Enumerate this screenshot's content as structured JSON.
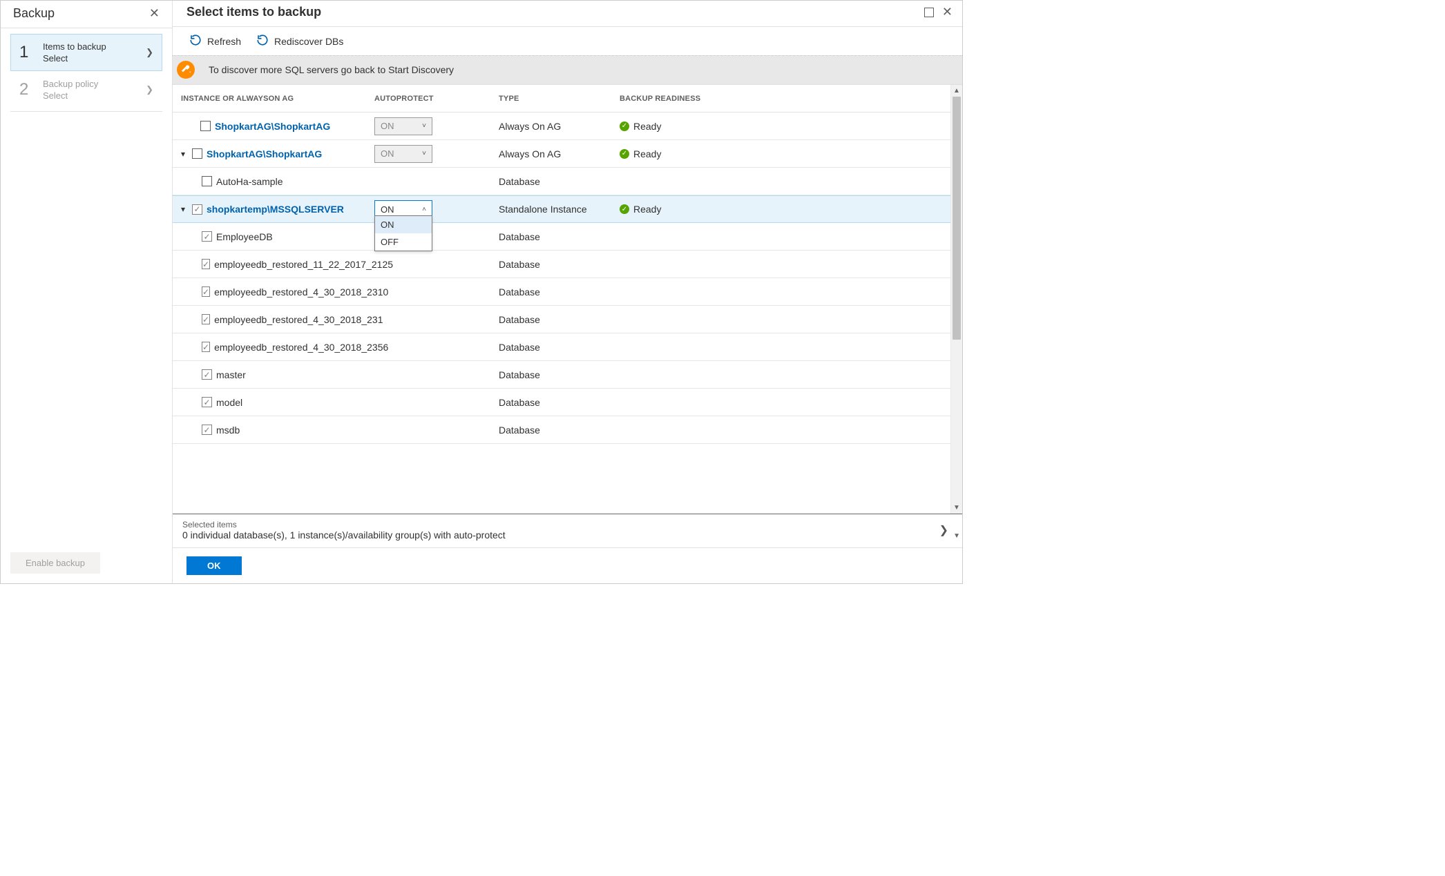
{
  "left": {
    "title": "Backup",
    "steps": [
      {
        "num": "1",
        "label": "Items to backup",
        "sub": "Select",
        "active": true
      },
      {
        "num": "2",
        "label": "Backup policy",
        "sub": "Select",
        "active": false
      }
    ],
    "enable_button": "Enable backup"
  },
  "right": {
    "title": "Select items to backup",
    "toolbar": {
      "refresh": "Refresh",
      "rediscover": "Rediscover DBs"
    },
    "banner": "To discover more SQL servers go back to Start Discovery",
    "headers": {
      "instance": "INSTANCE OR ALWAYSON AG",
      "autoprotect": "AUTOPROTECT",
      "type": "TYPE",
      "readiness": "BACKUP READINESS"
    },
    "rows": [
      {
        "kind": "instance",
        "indent": 1,
        "caret": "",
        "checked": false,
        "link": true,
        "name": "ShopkartAG\\ShopkartAG",
        "autoprotect": "ON",
        "ap_disabled": true,
        "type": "Always On AG",
        "ready": true
      },
      {
        "kind": "instance",
        "indent": 0,
        "caret": "▾",
        "checked": false,
        "link": true,
        "name": "ShopkartAG\\ShopkartAG",
        "autoprotect": "ON",
        "ap_disabled": true,
        "type": "Always On AG",
        "ready": true
      },
      {
        "kind": "db",
        "indent": 2,
        "checked": false,
        "name": "AutoHa-sample",
        "type": "Database"
      },
      {
        "kind": "instance",
        "indent": 0,
        "caret": "▾",
        "checked": true,
        "link": true,
        "name": "shopkartemp\\MSSQLSERVER",
        "autoprotect": "ON",
        "ap_open": true,
        "type": "Standalone Instance",
        "ready": true,
        "highlighted": true
      },
      {
        "kind": "db",
        "indent": 2,
        "checked": true,
        "name": "EmployeeDB",
        "type": "Database"
      },
      {
        "kind": "db",
        "indent": 2,
        "checked": true,
        "name": "employeedb_restored_11_22_2017_2125",
        "type": "Database"
      },
      {
        "kind": "db",
        "indent": 2,
        "checked": true,
        "name": "employeedb_restored_4_30_2018_2310",
        "type": "Database"
      },
      {
        "kind": "db",
        "indent": 2,
        "checked": true,
        "name": "employeedb_restored_4_30_2018_231",
        "type": "Database"
      },
      {
        "kind": "db",
        "indent": 2,
        "checked": true,
        "name": "employeedb_restored_4_30_2018_2356",
        "type": "Database"
      },
      {
        "kind": "db",
        "indent": 2,
        "checked": true,
        "name": "master",
        "type": "Database"
      },
      {
        "kind": "db",
        "indent": 2,
        "checked": true,
        "name": "model",
        "type": "Database"
      },
      {
        "kind": "db",
        "indent": 2,
        "checked": true,
        "name": "msdb",
        "type": "Database"
      }
    ],
    "dropdown": {
      "options": [
        "ON",
        "OFF"
      ],
      "selected": "ON"
    },
    "readiness_label": "Ready",
    "selected": {
      "label": "Selected items",
      "value": "0 individual database(s), 1 instance(s)/availability group(s) with auto-protect"
    },
    "ok_button": "OK"
  }
}
